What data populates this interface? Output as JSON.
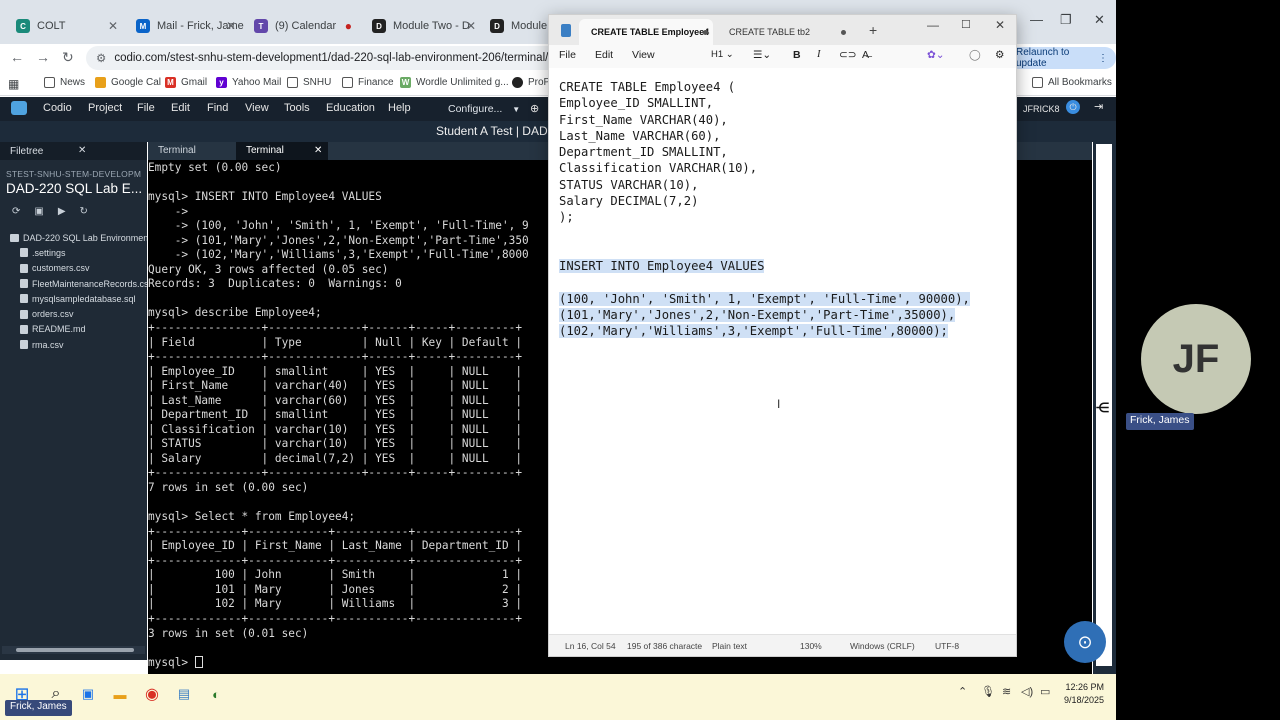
{
  "browser": {
    "tabs": [
      {
        "label": "COLT",
        "color": "#1a8a7a"
      },
      {
        "label": "Mail - Frick, James",
        "color": "#0a64c9"
      },
      {
        "label": "(9) Calendar",
        "color": "#6247aa"
      },
      {
        "label": "Module Two - D",
        "color": "#222222"
      },
      {
        "label": "Module Tw",
        "color": "#222222"
      }
    ],
    "url": "codio.com/stest-snhu-stem-development1/dad-220-sql-lab-environment-206/terminal/backend",
    "relaunch_label": "Relaunch to update",
    "bookmarks": [
      "News",
      "Google Cal",
      "Gmail",
      "Yahoo Mail",
      "SNHU",
      "Finance",
      "Wordle Unlimited g...",
      "ProP"
    ],
    "all_bookmarks": "All Bookmarks"
  },
  "codio": {
    "menu": [
      "Codio",
      "Project",
      "File",
      "Edit",
      "Find",
      "View",
      "Tools",
      "Education",
      "Help"
    ],
    "configure_label": "Configure...",
    "user": "JFRICK8",
    "student_title": "Student A Test | DAD-"
  },
  "filetree": {
    "tab_label": "Filetree",
    "project_small": "STEST-SNHU-STEM-DEVELOPMEN",
    "project_name": "DAD-220 SQL Lab E...",
    "root": "DAD-220 SQL Lab Environment",
    "files": [
      ".settings",
      "customers.csv",
      "FleetMaintenanceRecords.csv",
      "mysqlsampledatabase.sql",
      "orders.csv",
      "README.md",
      "rma.csv"
    ]
  },
  "terminal": {
    "tabs": [
      "Terminal",
      "Terminal"
    ],
    "lines": [
      "Empty set (0.00 sec)",
      "",
      "mysql> INSERT INTO Employee4 VALUES",
      "    ->",
      "    -> (100, 'John', 'Smith', 1, 'Exempt', 'Full-Time', 9",
      "    -> (101,'Mary','Jones',2,'Non-Exempt','Part-Time',350",
      "    -> (102,'Mary','Williams',3,'Exempt','Full-Time',8000",
      "Query OK, 3 rows affected (0.05 sec)",
      "Records: 3  Duplicates: 0  Warnings: 0",
      "",
      "mysql> describe Employee4;",
      "+----------------+--------------+------+-----+---------+",
      "| Field          | Type         | Null | Key | Default |",
      "+----------------+--------------+------+-----+---------+",
      "| Employee_ID    | smallint     | YES  |     | NULL    |",
      "| First_Name     | varchar(40)  | YES  |     | NULL    |",
      "| Last_Name      | varchar(60)  | YES  |     | NULL    |",
      "| Department_ID  | smallint     | YES  |     | NULL    |",
      "| Classification | varchar(10)  | YES  |     | NULL    |",
      "| STATUS         | varchar(10)  | YES  |     | NULL    |",
      "| Salary         | decimal(7,2) | YES  |     | NULL    |",
      "+----------------+--------------+------+-----+---------+",
      "7 rows in set (0.00 sec)",
      "",
      "mysql> Select * from Employee4;",
      "+-------------+------------+-----------+---------------+",
      "| Employee_ID | First_Name | Last_Name | Department_ID |",
      "+-------------+------------+-----------+---------------+",
      "|         100 | John       | Smith     |             1 |",
      "|         101 | Mary       | Jones     |             2 |",
      "|         102 | Mary       | Williams  |             3 |",
      "+-------------+------------+-----------+---------------+",
      "3 rows in set (0.01 sec)",
      ""
    ],
    "prompt": "mysql> "
  },
  "notepad": {
    "tabs": [
      "CREATE TABLE Employee4",
      "CREATE TABLE tb2"
    ],
    "menu": [
      "File",
      "Edit",
      "View"
    ],
    "heading_label": "H1",
    "plain_lines": [
      "CREATE TABLE Employee4 (",
      "Employee_ID SMALLINT,",
      "First_Name VARCHAR(40),",
      "Last_Name VARCHAR(60),",
      "Department_ID SMALLINT,",
      "Classification VARCHAR(10),",
      "STATUS VARCHAR(10),",
      "Salary DECIMAL(7,2)",
      ");",
      "",
      ""
    ],
    "selected_lines": [
      "INSERT INTO Employee4 VALUES",
      "",
      "(100, 'John', 'Smith', 1, 'Exempt', 'Full-Time', 90000),",
      "(101,'Mary','Jones',2,'Non-Exempt','Part-Time',35000),",
      "(102,'Mary','Williams',3,'Exempt','Full-Time',80000);"
    ],
    "status": {
      "position": "Ln 16, Col 54",
      "chars": "195 of 386 characte",
      "format": "Plain text",
      "zoom": "130%",
      "line_ending": "Windows (CRLF)",
      "encoding": "UTF-8"
    }
  },
  "taskbar": {
    "time": "12:26 PM",
    "date": "9/18/2025",
    "presenter_label": "Frick, James"
  },
  "participant": {
    "initials": "JF",
    "name": "Frick, James"
  }
}
